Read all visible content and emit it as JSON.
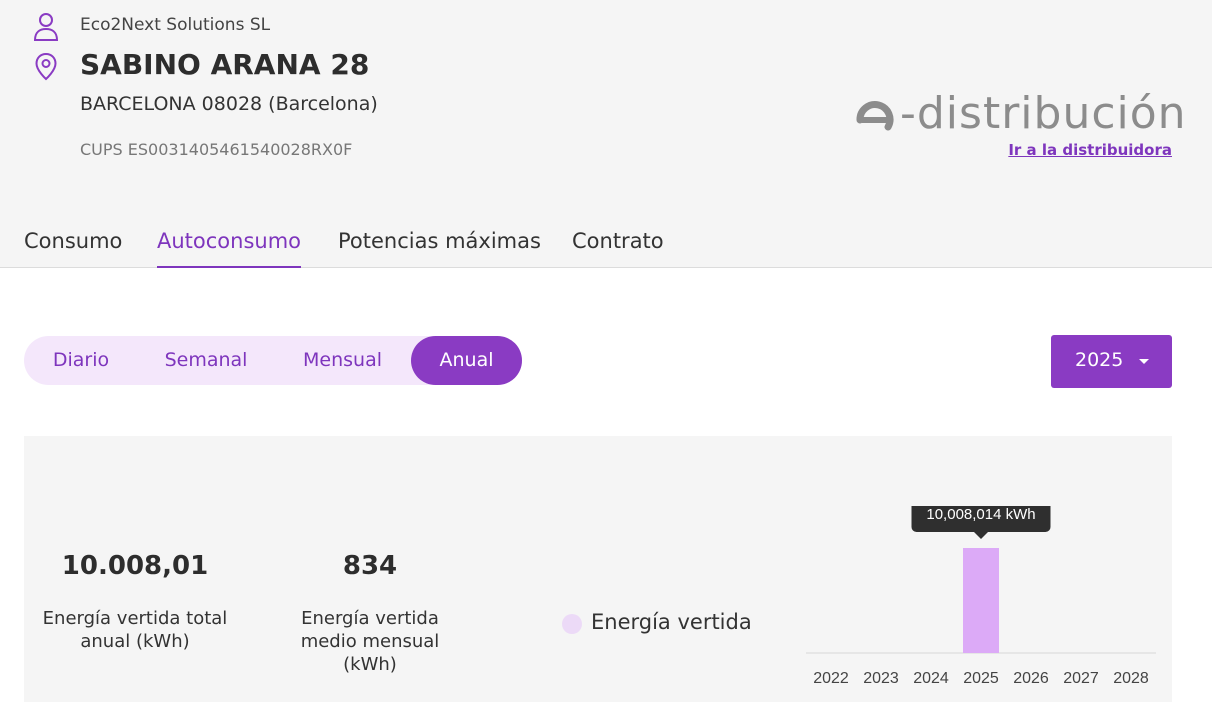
{
  "header": {
    "company": "Eco2Next Solutions SL",
    "street": "SABINO ARANA 28",
    "city": "BARCELONA 08028 (Barcelona)",
    "cups": "CUPS ES0031405461540028RX0F",
    "logo_text": "-distribución",
    "distributor_link": "Ir a la distribuidora",
    "icons": {
      "user": "user-icon",
      "location": "location-pin-icon"
    }
  },
  "tabs": [
    "Consumo",
    "Autoconsumo",
    "Potencias máximas",
    "Contrato"
  ],
  "active_tab": "Autoconsumo",
  "period_selector": {
    "options": [
      "Diario",
      "Semanal",
      "Mensual",
      "Anual"
    ],
    "selected": "Anual"
  },
  "year_dropdown": {
    "value": "2025"
  },
  "stats": [
    {
      "value": "10.008,01",
      "label_lines": [
        "Energía vertida total",
        "anual (kWh)"
      ]
    },
    {
      "value": "834",
      "label_lines": [
        "Energía vertida",
        "medio mensual",
        "(kWh)"
      ]
    }
  ],
  "legend": {
    "label": "Energía vertida"
  },
  "chart_data": {
    "type": "bar",
    "categories": [
      "2022",
      "2023",
      "2024",
      "2025",
      "2026",
      "2027",
      "2028"
    ],
    "values": [
      0,
      0,
      0,
      10008.014,
      0,
      0,
      0
    ],
    "tooltip": {
      "category": "2025",
      "text": "10,008,014 kWh"
    },
    "title": "",
    "xlabel": "",
    "ylabel": ""
  },
  "colors": {
    "accent": "#7e35bd",
    "button": "#8a3bc3",
    "pill_bg": "#f4e7fb",
    "bar": "#dcaaf7",
    "legend_dot": "#ecdaf7",
    "logo": "#8c8c8c",
    "tooltip": "#2f2f2f"
  }
}
